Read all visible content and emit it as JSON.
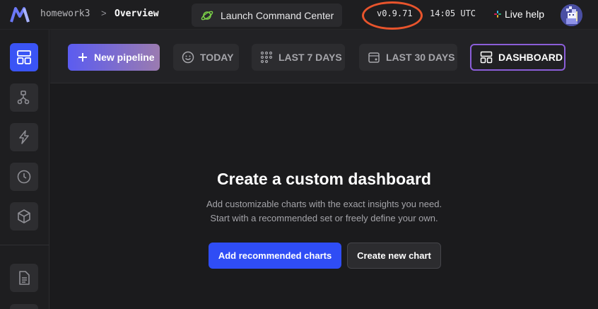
{
  "header": {
    "project": "homework3",
    "separator": ">",
    "page": "Overview",
    "launch_label": "Launch Command Center",
    "version": "v0.9.71",
    "time": "14:05 UTC",
    "live_help": "Live help"
  },
  "toolbar": {
    "new_pipeline": "New pipeline",
    "today": "TODAY",
    "last_7_days": "LAST 7 DAYS",
    "last_30_days": "LAST 30 DAYS",
    "dashboard": "DASHBOARD"
  },
  "empty_state": {
    "title": "Create a custom dashboard",
    "line1": "Add customizable charts with the exact insights you need.",
    "line2": "Start with a recommended set or freely define your own.",
    "primary": "Add recommended charts",
    "secondary": "Create new chart"
  },
  "sidebar": {
    "items": [
      "overview-icon",
      "pipelines-icon",
      "triggers-icon",
      "history-icon",
      "blocks-icon",
      "files-icon"
    ]
  },
  "colors": {
    "accent": "#3a54f5",
    "highlight_ring": "#e8542c",
    "dashboard_border": "#8b5ed8"
  }
}
